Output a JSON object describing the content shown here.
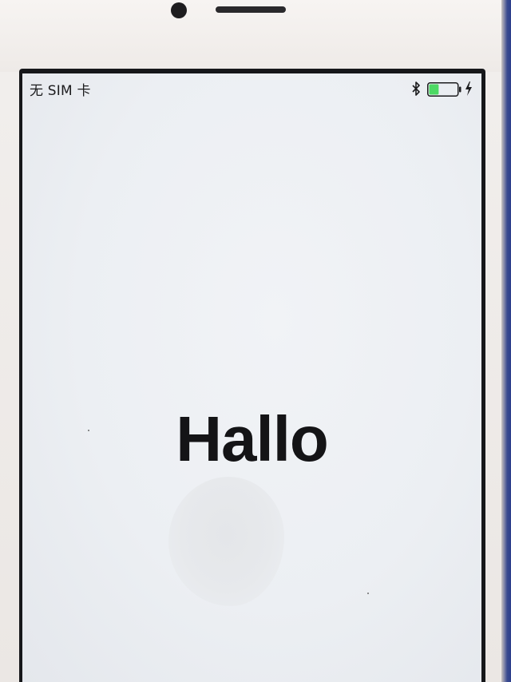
{
  "status_bar": {
    "carrier": "无 SIM 卡",
    "bluetooth_icon": "bluetooth-icon",
    "battery_icon": "battery-icon",
    "battery_level": 0.35,
    "battery_color": "#4cd964",
    "charging_icon": "charging-bolt-icon"
  },
  "welcome": {
    "greeting": "Hallo"
  }
}
